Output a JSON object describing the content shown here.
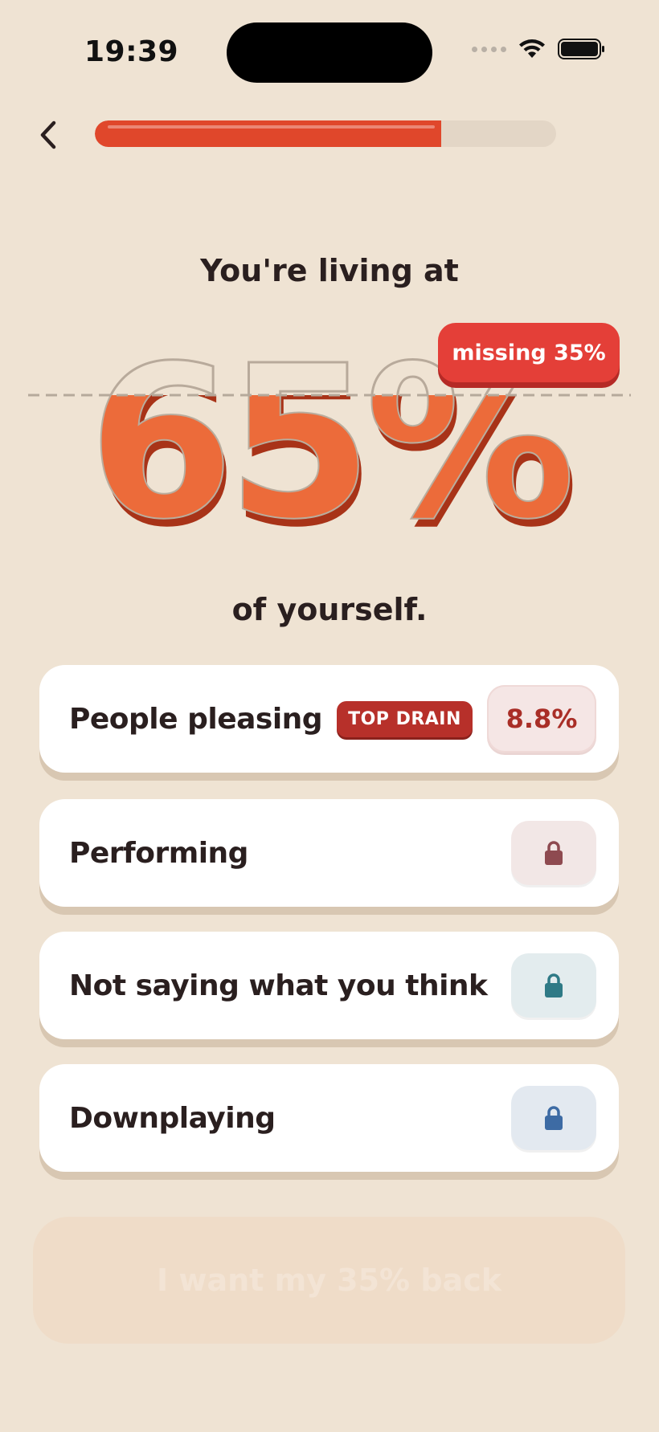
{
  "status": {
    "time": "19:39"
  },
  "progress": {
    "value": 0.75
  },
  "result": {
    "headline": "You're living at",
    "percent": "65%",
    "missing_label": "missing 35%",
    "subline": "of yourself."
  },
  "drains": [
    {
      "label": "People pleasing",
      "badge": "TOP DRAIN",
      "value": "8.8%"
    },
    {
      "label": "Performing",
      "lock_icon": "lock-icon",
      "color": "#8e4a50",
      "bg": "#f2e7e6"
    },
    {
      "label": "Not saying what you think",
      "lock_icon": "lock-icon",
      "color": "#2f7a86",
      "bg": "#e3ecee"
    },
    {
      "label": "Downplaying",
      "lock_icon": "lock-icon",
      "color": "#3d6ba4",
      "bg": "#e3e9f0"
    }
  ],
  "cta": {
    "label": "I want my 35% back"
  },
  "colors": {
    "accent": "#e0472b",
    "fill_orange": "#ec6b3a",
    "badge_red": "#e43f38",
    "background": "#efe3d3"
  }
}
